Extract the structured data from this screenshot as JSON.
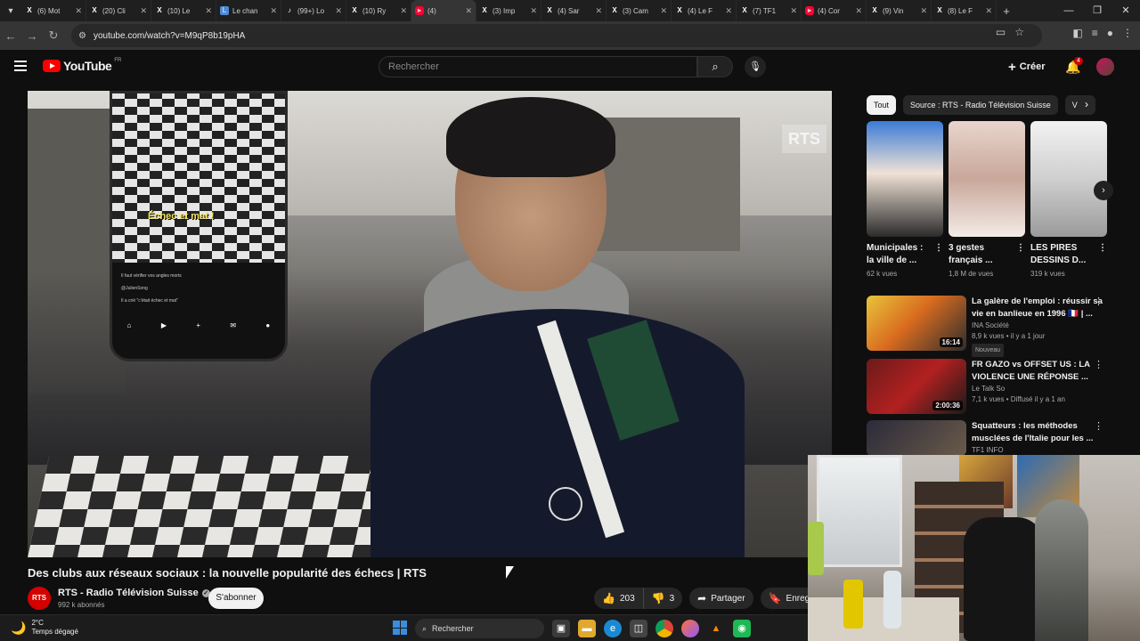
{
  "browser": {
    "tabs": [
      {
        "title": "(6) Mot",
        "icon": "x-icon",
        "active": false
      },
      {
        "title": "(20) Cli",
        "icon": "x-icon",
        "active": false
      },
      {
        "title": "(10) Le",
        "icon": "x-icon",
        "active": false
      },
      {
        "title": "Le chan",
        "icon": "web-icon",
        "active": false
      },
      {
        "title": "(99+) Lo",
        "icon": "tiktok-icon",
        "active": false
      },
      {
        "title": "(10) Ry",
        "icon": "x-icon",
        "active": false
      },
      {
        "title": "(4)",
        "icon": "youtube-icon",
        "active": true
      },
      {
        "title": "(3) Imp",
        "icon": "x-icon",
        "active": false
      },
      {
        "title": "(4) Sar",
        "icon": "x-icon",
        "active": false
      },
      {
        "title": "(3) Cam",
        "icon": "x-icon",
        "active": false
      },
      {
        "title": "(4) Le F",
        "icon": "x-icon",
        "active": false
      },
      {
        "title": "(7) TF1",
        "icon": "x-icon",
        "active": false
      },
      {
        "title": "(4) Cor",
        "icon": "youtube-icon",
        "active": false
      },
      {
        "title": "(9) Vin",
        "icon": "x-icon",
        "active": false
      },
      {
        "title": "(8) Le F",
        "icon": "x-icon",
        "active": false
      }
    ],
    "url": "youtube.com/watch?v=M9qP8b19pHA"
  },
  "youtube": {
    "logo_text": "YouTube",
    "country": "FR",
    "search_placeholder": "Rechercher",
    "create_label": "Créer",
    "notif_count": "4"
  },
  "video": {
    "watermark": "RTS",
    "phone_caption": "Échec et mat !",
    "phone_comment_1": "Il faut vérifier vos angles morts",
    "phone_user": "@JulienSong",
    "phone_comment_2": "Il a crié \"c'était échec et mat\"",
    "title": "Des clubs aux réseaux sociaux : la nouvelle popularité des échecs | RTS",
    "channel_avatar": "RTS",
    "channel_name": "RTS - Radio Télévision Suisse",
    "subscribers": "992 k abonnés",
    "subscribe_label": "S'abonner",
    "likes": "203",
    "dislikes": "3",
    "share_label": "Partager",
    "save_label": "Enregis"
  },
  "sidebar": {
    "chips": [
      "Tout",
      "Source : RTS - Radio Télévision Suisse",
      "V"
    ],
    "shorts": [
      {
        "title": "Municipales : la ville de ...",
        "views": "62 k vues"
      },
      {
        "title": "3 gestes français ...",
        "views": "1,8 M de vues"
      },
      {
        "title": "LES PIRES DESSINS D...",
        "views": "319 k vues"
      }
    ],
    "recommendations": [
      {
        "title": "La galère de l'emploi : réussir sa vie en banlieue en 1996 🇫🇷 | ...",
        "channel": "INA Société",
        "meta": "8,9 k vues • il y a 1 jour",
        "badge": "Nouveau",
        "duration": "16:14"
      },
      {
        "title": "FR GAZO vs OFFSET US : LA VIOLENCE UNE RÉPONSE ...",
        "channel": "Le Talk So",
        "meta": "7,1 k vues • Diffusé il y a 1 an",
        "badge": "",
        "duration": "2:00:36"
      },
      {
        "title": "Squatteurs : les méthodes musclées de l'Italie pour les ...",
        "channel": "TF1 INFO",
        "meta": "",
        "badge": "",
        "duration": ""
      }
    ]
  },
  "taskbar": {
    "temperature": "2°C",
    "weather": "Temps dégagé",
    "search_label": "Rechercher"
  }
}
